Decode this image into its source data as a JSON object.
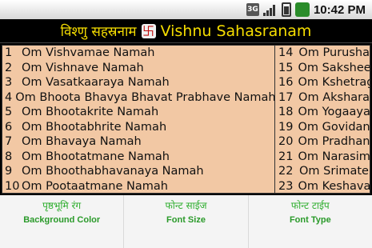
{
  "statusbar": {
    "network": "3G",
    "time": "10:42 PM"
  },
  "title": {
    "hindi": "विश्णु सहस्रनाम",
    "symbol": "卐",
    "english": "Vishnu Sahasranam"
  },
  "names_main": [
    {
      "num": "1",
      "text": "Om Vishvamae Namah"
    },
    {
      "num": "2",
      "text": "Om Vishnave Namah"
    },
    {
      "num": "3",
      "text": "Om Vasatkaaraya Namah"
    },
    {
      "num": "4",
      "text": "Om Bhoota Bhavya Bhavat Prabhave Namah"
    },
    {
      "num": "5",
      "text": "Om Bhootakrite Namah"
    },
    {
      "num": "6",
      "text": "Om Bhootabhrite Namah"
    },
    {
      "num": "7",
      "text": "Om Bhavaya Namah"
    },
    {
      "num": "8",
      "text": "Om Bhootatmane Namah"
    },
    {
      "num": "9",
      "text": "Om Bhoothabhavanaya Namah"
    },
    {
      "num": "10",
      "text": "Om Pootaatmane Namah"
    }
  ],
  "names_side": [
    {
      "num": "14",
      "text": "Om Purusha"
    },
    {
      "num": "15",
      "text": "Om Sakshee"
    },
    {
      "num": "16",
      "text": "Om Kshetrag"
    },
    {
      "num": "17",
      "text": "Om Akshara"
    },
    {
      "num": "18",
      "text": "Om Yogaaya"
    },
    {
      "num": "19",
      "text": "Om Govidan"
    },
    {
      "num": "20",
      "text": "Om Pradhan"
    },
    {
      "num": "21",
      "text": "Om Narasim"
    },
    {
      "num": "22",
      "text": "Om Srimate"
    },
    {
      "num": "23",
      "text": "Om Keshava"
    }
  ],
  "menu": [
    {
      "hindi": "पृष्ठभूमि रंग",
      "english": "Background Color"
    },
    {
      "hindi": "फोन्ट साईज",
      "english": "Font Size"
    },
    {
      "hindi": "फोन्ट टाईप",
      "english": "Font Type"
    }
  ]
}
